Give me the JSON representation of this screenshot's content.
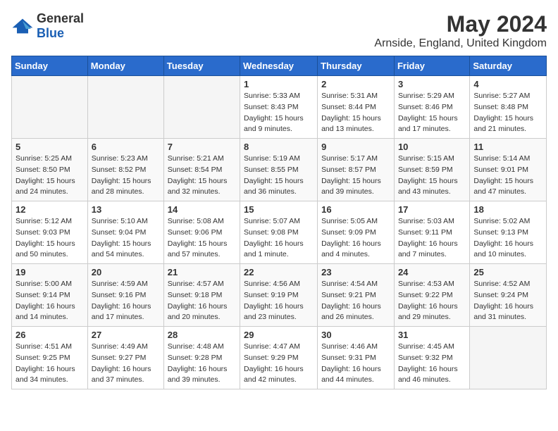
{
  "logo": {
    "general": "General",
    "blue": "Blue"
  },
  "title": "May 2024",
  "location": "Arnside, England, United Kingdom",
  "days_of_week": [
    "Sunday",
    "Monday",
    "Tuesday",
    "Wednesday",
    "Thursday",
    "Friday",
    "Saturday"
  ],
  "weeks": [
    [
      {
        "day": "",
        "info": ""
      },
      {
        "day": "",
        "info": ""
      },
      {
        "day": "",
        "info": ""
      },
      {
        "day": "1",
        "info": "Sunrise: 5:33 AM\nSunset: 8:43 PM\nDaylight: 15 hours\nand 9 minutes."
      },
      {
        "day": "2",
        "info": "Sunrise: 5:31 AM\nSunset: 8:44 PM\nDaylight: 15 hours\nand 13 minutes."
      },
      {
        "day": "3",
        "info": "Sunrise: 5:29 AM\nSunset: 8:46 PM\nDaylight: 15 hours\nand 17 minutes."
      },
      {
        "day": "4",
        "info": "Sunrise: 5:27 AM\nSunset: 8:48 PM\nDaylight: 15 hours\nand 21 minutes."
      }
    ],
    [
      {
        "day": "5",
        "info": "Sunrise: 5:25 AM\nSunset: 8:50 PM\nDaylight: 15 hours\nand 24 minutes."
      },
      {
        "day": "6",
        "info": "Sunrise: 5:23 AM\nSunset: 8:52 PM\nDaylight: 15 hours\nand 28 minutes."
      },
      {
        "day": "7",
        "info": "Sunrise: 5:21 AM\nSunset: 8:54 PM\nDaylight: 15 hours\nand 32 minutes."
      },
      {
        "day": "8",
        "info": "Sunrise: 5:19 AM\nSunset: 8:55 PM\nDaylight: 15 hours\nand 36 minutes."
      },
      {
        "day": "9",
        "info": "Sunrise: 5:17 AM\nSunset: 8:57 PM\nDaylight: 15 hours\nand 39 minutes."
      },
      {
        "day": "10",
        "info": "Sunrise: 5:15 AM\nSunset: 8:59 PM\nDaylight: 15 hours\nand 43 minutes."
      },
      {
        "day": "11",
        "info": "Sunrise: 5:14 AM\nSunset: 9:01 PM\nDaylight: 15 hours\nand 47 minutes."
      }
    ],
    [
      {
        "day": "12",
        "info": "Sunrise: 5:12 AM\nSunset: 9:03 PM\nDaylight: 15 hours\nand 50 minutes."
      },
      {
        "day": "13",
        "info": "Sunrise: 5:10 AM\nSunset: 9:04 PM\nDaylight: 15 hours\nand 54 minutes."
      },
      {
        "day": "14",
        "info": "Sunrise: 5:08 AM\nSunset: 9:06 PM\nDaylight: 15 hours\nand 57 minutes."
      },
      {
        "day": "15",
        "info": "Sunrise: 5:07 AM\nSunset: 9:08 PM\nDaylight: 16 hours\nand 1 minute."
      },
      {
        "day": "16",
        "info": "Sunrise: 5:05 AM\nSunset: 9:09 PM\nDaylight: 16 hours\nand 4 minutes."
      },
      {
        "day": "17",
        "info": "Sunrise: 5:03 AM\nSunset: 9:11 PM\nDaylight: 16 hours\nand 7 minutes."
      },
      {
        "day": "18",
        "info": "Sunrise: 5:02 AM\nSunset: 9:13 PM\nDaylight: 16 hours\nand 10 minutes."
      }
    ],
    [
      {
        "day": "19",
        "info": "Sunrise: 5:00 AM\nSunset: 9:14 PM\nDaylight: 16 hours\nand 14 minutes."
      },
      {
        "day": "20",
        "info": "Sunrise: 4:59 AM\nSunset: 9:16 PM\nDaylight: 16 hours\nand 17 minutes."
      },
      {
        "day": "21",
        "info": "Sunrise: 4:57 AM\nSunset: 9:18 PM\nDaylight: 16 hours\nand 20 minutes."
      },
      {
        "day": "22",
        "info": "Sunrise: 4:56 AM\nSunset: 9:19 PM\nDaylight: 16 hours\nand 23 minutes."
      },
      {
        "day": "23",
        "info": "Sunrise: 4:54 AM\nSunset: 9:21 PM\nDaylight: 16 hours\nand 26 minutes."
      },
      {
        "day": "24",
        "info": "Sunrise: 4:53 AM\nSunset: 9:22 PM\nDaylight: 16 hours\nand 29 minutes."
      },
      {
        "day": "25",
        "info": "Sunrise: 4:52 AM\nSunset: 9:24 PM\nDaylight: 16 hours\nand 31 minutes."
      }
    ],
    [
      {
        "day": "26",
        "info": "Sunrise: 4:51 AM\nSunset: 9:25 PM\nDaylight: 16 hours\nand 34 minutes."
      },
      {
        "day": "27",
        "info": "Sunrise: 4:49 AM\nSunset: 9:27 PM\nDaylight: 16 hours\nand 37 minutes."
      },
      {
        "day": "28",
        "info": "Sunrise: 4:48 AM\nSunset: 9:28 PM\nDaylight: 16 hours\nand 39 minutes."
      },
      {
        "day": "29",
        "info": "Sunrise: 4:47 AM\nSunset: 9:29 PM\nDaylight: 16 hours\nand 42 minutes."
      },
      {
        "day": "30",
        "info": "Sunrise: 4:46 AM\nSunset: 9:31 PM\nDaylight: 16 hours\nand 44 minutes."
      },
      {
        "day": "31",
        "info": "Sunrise: 4:45 AM\nSunset: 9:32 PM\nDaylight: 16 hours\nand 46 minutes."
      },
      {
        "day": "",
        "info": ""
      }
    ]
  ]
}
